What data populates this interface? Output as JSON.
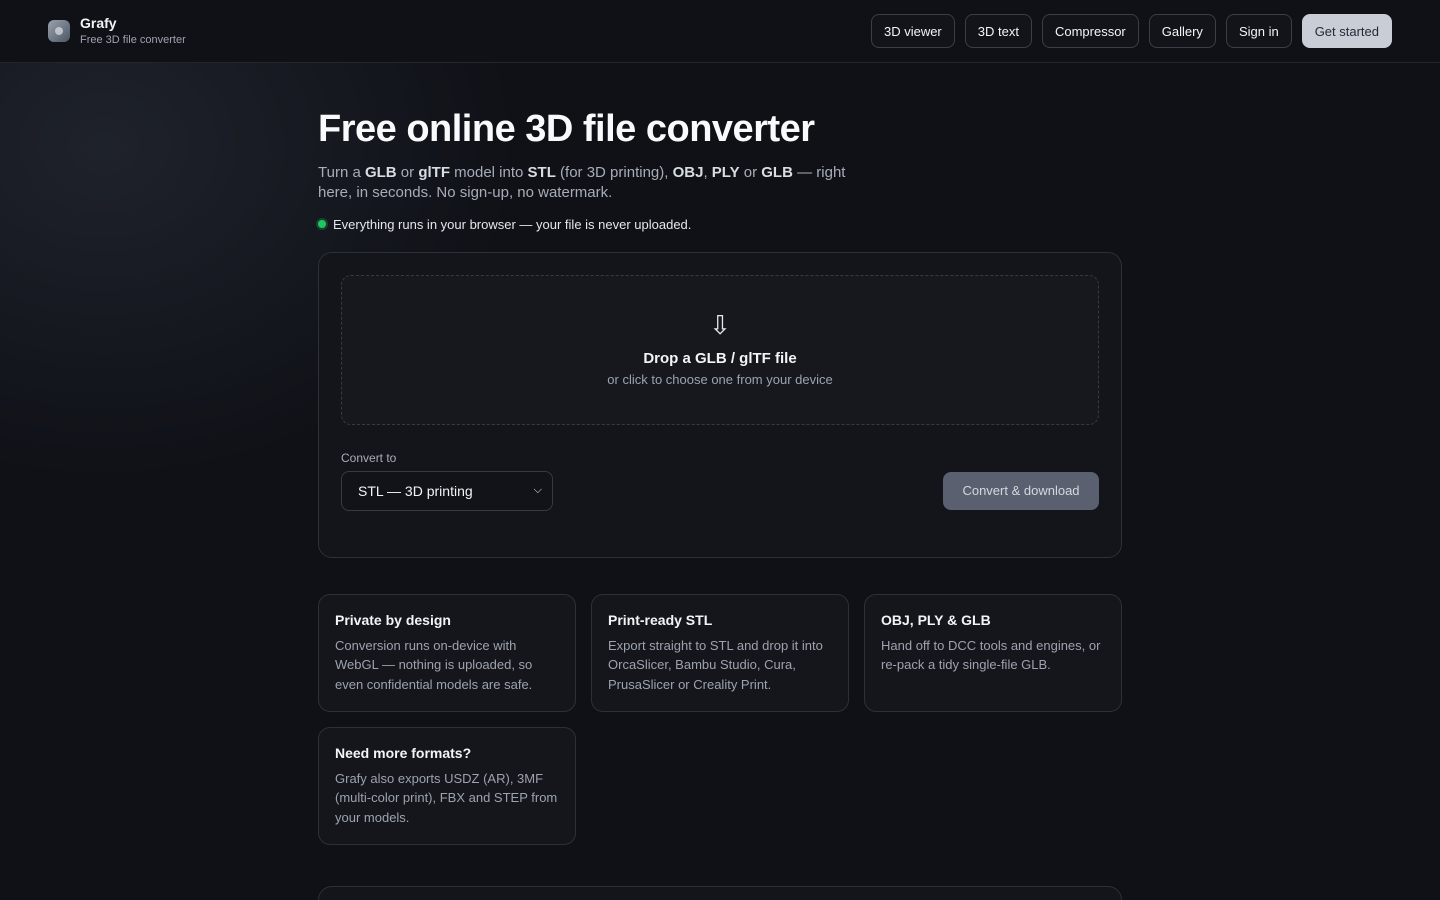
{
  "header": {
    "brand_name": "Grafy",
    "brand_sub": "Free 3D file converter",
    "nav": [
      "3D viewer",
      "3D text",
      "Compressor",
      "Gallery",
      "Sign in"
    ],
    "cta": "Get started"
  },
  "hero": {
    "title": "Free online 3D file converter",
    "lead_parts": [
      "Turn a ",
      "GLB",
      " or ",
      "glTF",
      " model into ",
      "STL",
      " (for 3D printing), ",
      "OBJ",
      ", ",
      "PLY",
      " or ",
      "GLB",
      " — right here, in seconds. No sign-up, no watermark."
    ],
    "privacy": "Everything runs in your browser — your file is never uploaded."
  },
  "converter": {
    "drop_icon": "⇩",
    "drop_title": "Drop a GLB / glTF file",
    "drop_sub": "or click to choose one from your device",
    "convert_label": "Convert to",
    "selected": "STL — 3D printing",
    "button": "Convert & download"
  },
  "features": [
    {
      "title": "Private by design",
      "text": "Conversion runs on-device with WebGL — nothing is uploaded, so even confidential models are safe."
    },
    {
      "title": "Print-ready STL",
      "text": "Export straight to STL and drop it into OrcaSlicer, Bambu Studio, Cura, PrusaSlicer or Creality Print."
    },
    {
      "title": "OBJ, PLY & GLB",
      "text": "Hand off to DCC tools and engines, or re-pack a tidy single-file GLB."
    },
    {
      "title": "Need more formats?",
      "text": "Grafy also exports USDZ (AR), 3MF (multi-color print), FBX and STEP from your models."
    }
  ],
  "colors": {
    "accent_dot": "#22c55e",
    "background": "#0f1117"
  }
}
